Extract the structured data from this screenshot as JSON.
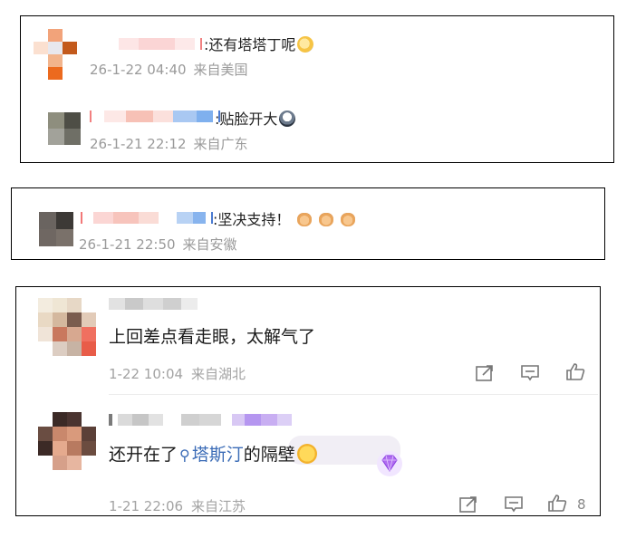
{
  "card1": {
    "comment1": {
      "text": ":还有塔塔丁呢",
      "date": "26-1-22 04:40",
      "location": "来自美国",
      "emoji_icon": "dizzy-face-icon"
    },
    "comment2": {
      "text": ":贴脸开大",
      "date": "26-1-21 22:12",
      "location": "来自广东",
      "emoji_icon": "scream-face-icon"
    }
  },
  "card2": {
    "comment1": {
      "text": ":坚决支持！",
      "date": "26-1-21 22:50",
      "location": "来自安徽",
      "emoji_icons": [
        "fist-icon",
        "fist-icon",
        "fist-icon"
      ]
    }
  },
  "card3": {
    "comment1": {
      "text": "上回差点看走眼，太解气了",
      "date": "1-22 10:04",
      "location": "来自湖北",
      "actions": [
        "share-icon",
        "comment-icon",
        "like-icon"
      ]
    },
    "comment2": {
      "text_before": "还开在了",
      "link_text": "塔斯汀",
      "text_after": "的隔壁",
      "date": "1-21 22:06",
      "location": "来自江苏",
      "like_count": "8",
      "emoji_icon": "laughing-tears-icon",
      "badge_icon": "diamond-badge-icon",
      "actions": [
        "share-icon",
        "comment-icon",
        "like-icon"
      ]
    }
  },
  "colors": {
    "link": "#3a6bb6",
    "meta": "#9a9a9a",
    "border": "#000000"
  }
}
